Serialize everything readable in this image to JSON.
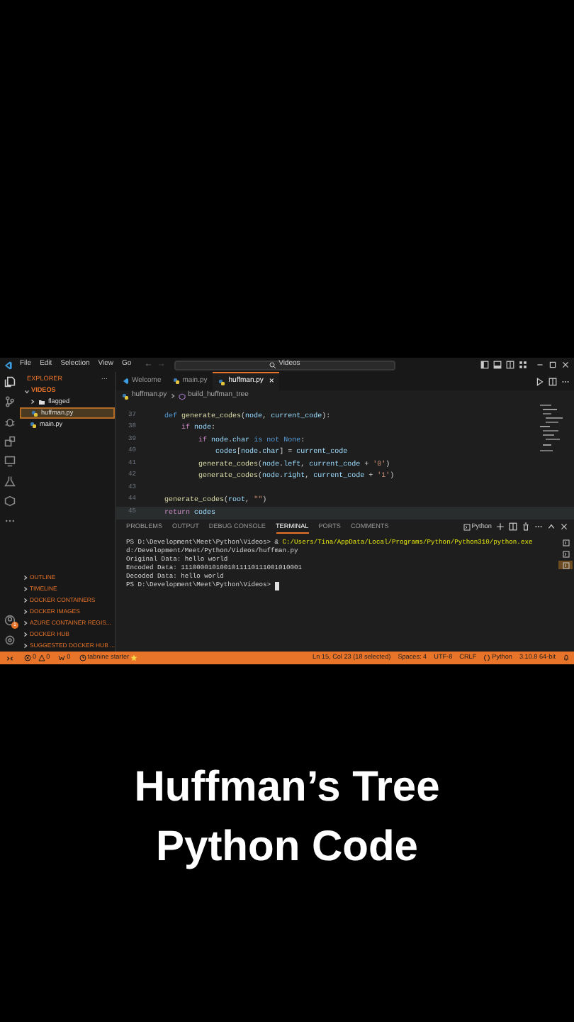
{
  "title_bar": {
    "menu": [
      "File",
      "Edit",
      "Selection",
      "View",
      "Go"
    ],
    "back": "←",
    "forward": "→",
    "search": "Videos"
  },
  "sidebar": {
    "header": "EXPLORER",
    "more": "···",
    "root": {
      "label": "VIDEOS",
      "expanded": true,
      "children": [
        {
          "label": "flagged",
          "kind": "folder",
          "expanded": false,
          "selected": false
        },
        {
          "label": "huffman.py",
          "kind": "file",
          "selected": true
        },
        {
          "label": "main.py",
          "kind": "file",
          "selected": false
        }
      ]
    },
    "sections": [
      {
        "label": "OUTLINE",
        "expanded": false
      },
      {
        "label": "TIMELINE",
        "expanded": false
      },
      {
        "label": "DOCKER CONTAINERS",
        "expanded": false
      },
      {
        "label": "DOCKER IMAGES",
        "expanded": false
      },
      {
        "label": "AZURE CONTAINER REGIS...",
        "expanded": false
      },
      {
        "label": "DOCKER HUB",
        "expanded": false
      },
      {
        "label": "SUGGESTED DOCKER HUB ...",
        "expanded": false
      }
    ]
  },
  "activity_badge": "1",
  "tabs": [
    {
      "label": "Welcome",
      "kind": "welcome",
      "selected": false
    },
    {
      "label": "main.py",
      "kind": "python",
      "selected": false
    },
    {
      "label": "huffman.py",
      "kind": "python",
      "selected": true,
      "close": "×"
    }
  ],
  "breadcrumb": [
    "huffman.py",
    "build_huffman_tree"
  ],
  "code": [
    {
      "n": "37",
      "segs": [
        {
          "kind": "keyword",
          "text": "    def"
        },
        {
          "kind": "function",
          "text": " generate_codes"
        },
        {
          "kind": "plain",
          "text": "("
        },
        {
          "kind": "name",
          "text": "node"
        },
        {
          "kind": "plain",
          "text": ", "
        },
        {
          "kind": "name",
          "text": "current_code"
        },
        {
          "kind": "plain",
          "text": "):"
        }
      ]
    },
    {
      "n": "38",
      "segs": [
        {
          "kind": "control",
          "text": "        if"
        },
        {
          "kind": "name",
          "text": " node"
        },
        {
          "kind": "plain",
          "text": ":"
        }
      ]
    },
    {
      "n": "39",
      "segs": [
        {
          "kind": "control",
          "text": "            if"
        },
        {
          "kind": "name",
          "text": " node"
        },
        {
          "kind": "plain",
          "text": "."
        },
        {
          "kind": "name",
          "text": "char"
        },
        {
          "kind": "keyword",
          "text": " is not None"
        },
        {
          "kind": "plain",
          "text": ":"
        }
      ]
    },
    {
      "n": "40",
      "segs": [
        {
          "kind": "name",
          "text": "                codes"
        },
        {
          "kind": "plain",
          "text": "["
        },
        {
          "kind": "name",
          "text": "node"
        },
        {
          "kind": "plain",
          "text": "."
        },
        {
          "kind": "name",
          "text": "char"
        },
        {
          "kind": "plain",
          "text": "] = "
        },
        {
          "kind": "name",
          "text": "current_code"
        }
      ]
    },
    {
      "n": "41",
      "segs": [
        {
          "kind": "function",
          "text": "            generate_codes"
        },
        {
          "kind": "plain",
          "text": "("
        },
        {
          "kind": "name",
          "text": "node"
        },
        {
          "kind": "plain",
          "text": "."
        },
        {
          "kind": "name",
          "text": "left"
        },
        {
          "kind": "plain",
          "text": ", "
        },
        {
          "kind": "name",
          "text": "current_code"
        },
        {
          "kind": "plain",
          "text": " + "
        },
        {
          "kind": "string",
          "text": "'0'"
        },
        {
          "kind": "plain",
          "text": ")"
        }
      ]
    },
    {
      "n": "42",
      "segs": [
        {
          "kind": "function",
          "text": "            generate_codes"
        },
        {
          "kind": "plain",
          "text": "("
        },
        {
          "kind": "name",
          "text": "node"
        },
        {
          "kind": "plain",
          "text": "."
        },
        {
          "kind": "name",
          "text": "right"
        },
        {
          "kind": "plain",
          "text": ", "
        },
        {
          "kind": "name",
          "text": "current_code"
        },
        {
          "kind": "plain",
          "text": " + "
        },
        {
          "kind": "string",
          "text": "'1'"
        },
        {
          "kind": "plain",
          "text": ")"
        }
      ]
    },
    {
      "n": "43"
    },
    {
      "n": "44",
      "segs": [
        {
          "kind": "function",
          "text": "    generate_codes"
        },
        {
          "kind": "plain",
          "text": "("
        },
        {
          "kind": "name",
          "text": "root"
        },
        {
          "kind": "plain",
          "text": ", "
        },
        {
          "kind": "string",
          "text": "\"\""
        },
        {
          "kind": "plain",
          "text": ")"
        }
      ]
    },
    {
      "n": "45",
      "segs": [
        {
          "kind": "control",
          "text": "    return"
        },
        {
          "kind": "name",
          "text": " codes"
        }
      ]
    }
  ],
  "panel_tabs": [
    {
      "label": "PROBLEMS",
      "selected": false
    },
    {
      "label": "OUTPUT",
      "selected": false
    },
    {
      "label": "DEBUG CONSOLE",
      "selected": false
    },
    {
      "label": "TERMINAL",
      "selected": true
    },
    {
      "label": "PORTS",
      "selected": false
    },
    {
      "label": "COMMENTS",
      "selected": false
    }
  ],
  "terminal_name": "Python",
  "terminal": [
    [
      {
        "kind": "plain",
        "text": "PS D:\\Development\\Meet\\Python\\Videos> & "
      },
      {
        "kind": "path",
        "text": "C:/Users/Tina/AppData/Local/Programs/Python/Python310/python.exe"
      }
    ],
    [
      {
        "kind": "plain",
        "text": "d:/Development/Meet/Python/Videos/huffman.py"
      }
    ],
    [
      {
        "kind": "plain",
        "text": "Original Data: hello world"
      }
    ],
    [
      {
        "kind": "plain",
        "text": "Encoded Data: 1110000101001011110111001010001"
      }
    ],
    [
      {
        "kind": "plain",
        "text": "Decoded Data: hello world"
      }
    ],
    [
      {
        "kind": "plain",
        "text": "PS D:\\Development\\Meet\\Python\\Videos> "
      },
      {
        "kind": "cursor"
      }
    ]
  ],
  "terminal_list": [
    {
      "selected": false
    },
    {
      "selected": false
    },
    {
      "selected": true
    }
  ],
  "status_bar": {
    "left": [
      {
        "kind": "problems",
        "errors": "0",
        "warnings": "0"
      },
      {
        "kind": "ports",
        "text": "0"
      },
      {
        "kind": "tabnine",
        "text": "tabnine starter"
      }
    ],
    "right": [
      "Ln 15, Col 23 (18 selected)",
      "Spaces: 4",
      "UTF-8",
      "CRLF",
      "Python",
      "3.10.8 64-bit"
    ]
  },
  "caption": "Huffman’s Tree\nPython Code"
}
